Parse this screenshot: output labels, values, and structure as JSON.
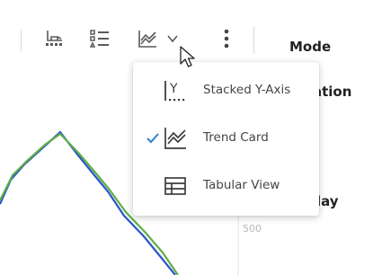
{
  "toolbar": {
    "icons": [
      "axis-settings-icon",
      "legend-list-icon",
      "trend-chart-icon",
      "chevron-down-icon",
      "more-vert-icon"
    ]
  },
  "right_panel": {
    "mode_label": "Mode",
    "item2_partial": "ation",
    "item3_partial": "lay"
  },
  "chart": {
    "tick_label": "500"
  },
  "view_menu": {
    "items": [
      {
        "label": "Stacked Y-Axis",
        "icon": "stacked-y-axis-icon",
        "checked": false
      },
      {
        "label": "Trend Card",
        "icon": "trend-card-icon",
        "checked": true
      },
      {
        "label": "Tabular View",
        "icon": "tabular-view-icon",
        "checked": false
      }
    ]
  },
  "colors": {
    "accent_check": "#2f80d1",
    "series_blue": "#2a55c9",
    "series_green": "#5fae44",
    "icon_dark": "#5a5a5a"
  }
}
